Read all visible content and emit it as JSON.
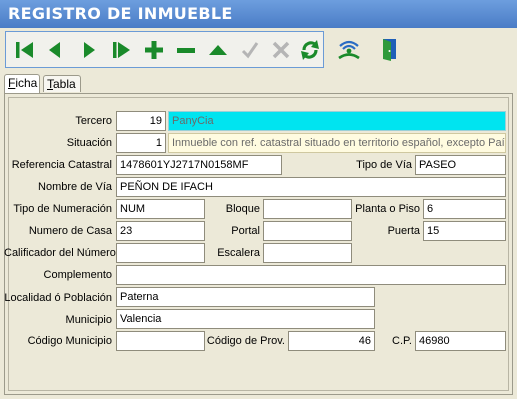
{
  "window": {
    "title": "REGISTRO DE INMUEBLE"
  },
  "toolbar": {
    "buttons": [
      {
        "name": "first-record",
        "icon": "skip-first-icon",
        "color": "#1a8a2a"
      },
      {
        "name": "previous-record",
        "icon": "triangle-left-icon",
        "color": "#1a8a2a"
      },
      {
        "name": "next-record",
        "icon": "triangle-right-icon",
        "color": "#1a8a2a"
      },
      {
        "name": "last-record",
        "icon": "skip-last-icon",
        "color": "#1a8a2a"
      },
      {
        "name": "add-record",
        "icon": "plus-icon",
        "color": "#1a8a2a"
      },
      {
        "name": "delete-record",
        "icon": "minus-icon",
        "color": "#1a8a2a"
      },
      {
        "name": "edit-record",
        "icon": "triangle-up-icon",
        "color": "#1a8a2a"
      },
      {
        "name": "confirm",
        "icon": "checkmark-icon",
        "color": "#b5b5b5"
      },
      {
        "name": "cancel",
        "icon": "x-icon",
        "color": "#b5b5b5"
      },
      {
        "name": "refresh",
        "icon": "refresh-icon",
        "color": "#1a8a2a"
      }
    ],
    "extra": [
      {
        "name": "catastro",
        "icon": "antenna-signal-icon"
      },
      {
        "name": "exit",
        "icon": "exit-door-icon"
      }
    ]
  },
  "tabs": [
    {
      "label_prefix": "",
      "label_key": "F",
      "label_rest": "icha",
      "active": true
    },
    {
      "label_prefix": "",
      "label_key": "T",
      "label_rest": "abla",
      "active": false
    }
  ],
  "form": {
    "tercero": {
      "label": "Tercero",
      "code": "19",
      "name": "PanyCia"
    },
    "situacion": {
      "label": "Situación",
      "code": "1",
      "text": "Inmueble con ref. catastral situado en territorio español, excepto País Vasco y Navarra"
    },
    "referencia_catastral": {
      "label": "Referencia Catastral",
      "value": "1478601YJ2717N0158MF"
    },
    "tipo_via": {
      "label": "Tipo de Vía",
      "value": "PASEO"
    },
    "nombre_via": {
      "label": "Nombre de Vía",
      "value": "PEÑON DE IFACH"
    },
    "tipo_numeracion": {
      "label": "Tipo de Numeración",
      "value": "NUM"
    },
    "bloque": {
      "label": "Bloque",
      "value": ""
    },
    "planta_piso": {
      "label": "Planta o Piso",
      "value": "6"
    },
    "numero_casa": {
      "label": "Numero de Casa",
      "value": "23"
    },
    "portal": {
      "label": "Portal",
      "value": ""
    },
    "puerta": {
      "label": "Puerta",
      "value": "15"
    },
    "calificador_numero": {
      "label": "Calificador del Número",
      "value": ""
    },
    "escalera": {
      "label": "Escalera",
      "value": ""
    },
    "complemento": {
      "label": "Complemento",
      "value": ""
    },
    "localidad": {
      "label": "Localidad ó Población",
      "value": "Paterna"
    },
    "municipio": {
      "label": "Municipio",
      "value": "Valencia"
    },
    "codigo_municipio": {
      "label": "Código Municipio",
      "value": ""
    },
    "codigo_prov": {
      "label": "Código de Prov.",
      "value": "46"
    },
    "cp": {
      "label": "C.P.",
      "value": "46980"
    }
  }
}
